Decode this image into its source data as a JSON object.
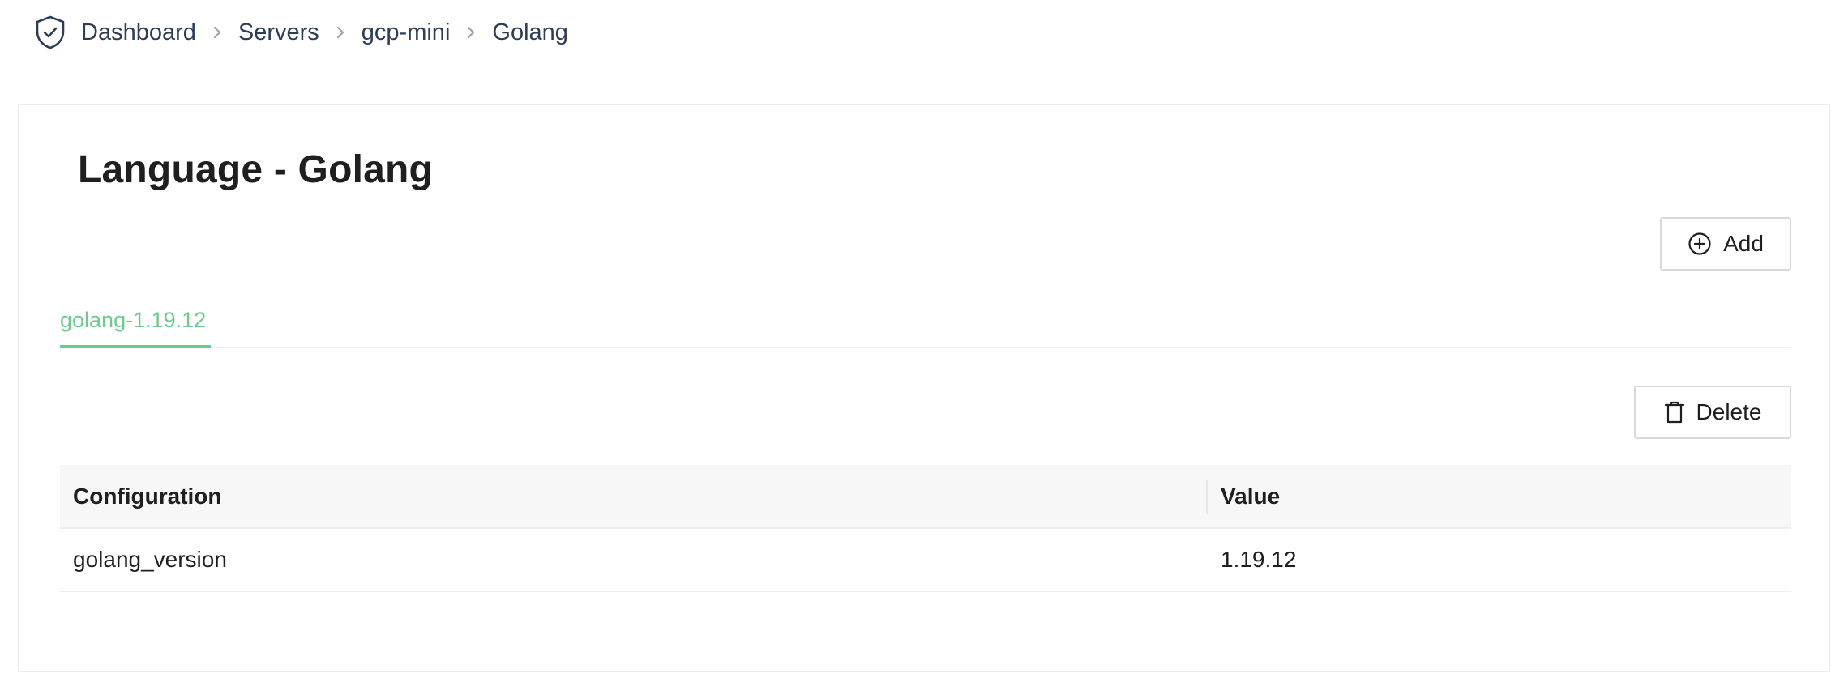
{
  "breadcrumb": {
    "logo_icon": "shield-check-icon",
    "items": [
      "Dashboard",
      "Servers",
      "gcp-mini",
      "Golang"
    ],
    "separator_icon": "chevron-right-icon"
  },
  "page": {
    "title": "Language - Golang"
  },
  "actions": {
    "add_label": "Add",
    "add_icon": "plus-circle-icon",
    "delete_label": "Delete",
    "delete_icon": "trash-icon"
  },
  "tabs": [
    {
      "label": "golang-1.19.12",
      "active": true
    }
  ],
  "table": {
    "columns": [
      "Configuration",
      "Value"
    ],
    "rows": [
      [
        "golang_version",
        "1.19.12"
      ]
    ]
  },
  "colors": {
    "accent": "#6cc98f",
    "breadcrumb_text": "#2e3d55",
    "header_bg": "#f7f7f7",
    "border": "#d9d9d9"
  }
}
